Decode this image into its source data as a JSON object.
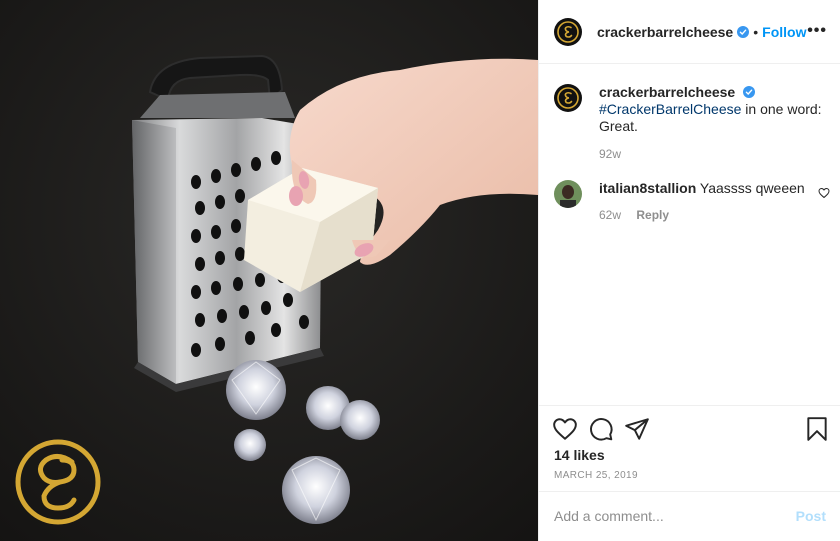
{
  "post": {
    "image_alt": "Cheese grater with a cheese cube and diamonds",
    "brand_color": "#d4a733"
  },
  "header": {
    "username": "crackerbarrelcheese",
    "separator": "•",
    "follow_label": "Follow",
    "more_label": "•••"
  },
  "caption": {
    "username": "crackerbarrelcheese",
    "hashtag": "#CrackerBarrelCheese",
    "text": " in one word: Great.",
    "time": "92w"
  },
  "comments": [
    {
      "username": "italian8stallion",
      "text": "Yaassss qweeen",
      "time": "62w",
      "reply_label": "Reply"
    }
  ],
  "actions": {
    "icons": [
      "heart-icon",
      "comment-icon",
      "share-icon",
      "bookmark-icon"
    ],
    "likes": "14 likes",
    "date": "MARCH 25, 2019"
  },
  "comment_box": {
    "placeholder": "Add a comment...",
    "post_label": "Post"
  },
  "colors": {
    "accent_blue": "#0095f6",
    "hashtag": "#00376b",
    "muted": "#8e8e8e",
    "post_disabled": "#b2dffc"
  }
}
